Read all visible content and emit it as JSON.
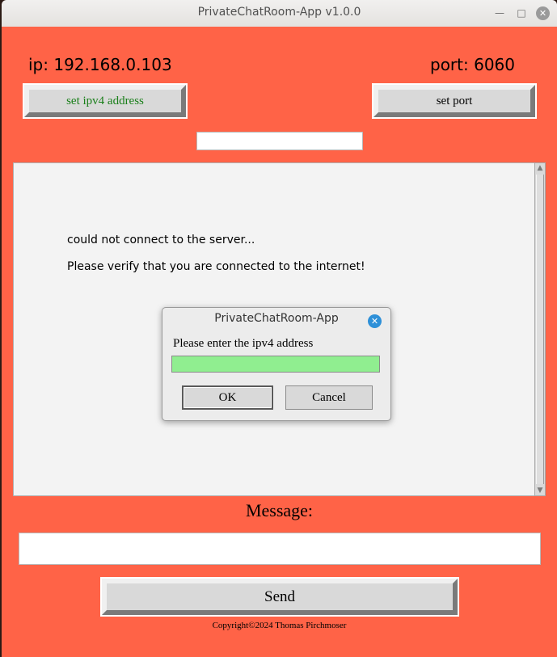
{
  "window": {
    "title": "PrivateChatRoom-App v1.0.0",
    "minimize_glyph": "—",
    "maximize_glyph": "□",
    "close_glyph": "✕"
  },
  "colors": {
    "background": "#ff6347",
    "dialog_entry": "#90ee90",
    "ip_button_text": "#1a7f1a"
  },
  "connection": {
    "ip_label": "ip: 192.168.0.103",
    "port_label": "port: 6060",
    "set_ip_button": "set ipv4 address",
    "set_port_button": "set port",
    "value_input": ""
  },
  "chat": {
    "lines": [
      "could not connect to the server...",
      "Please verify that you are connected to the internet!"
    ],
    "scroll_up_glyph": "▲",
    "scroll_down_glyph": "▼"
  },
  "composer": {
    "label": "Message:",
    "input_value": "",
    "send_button": "Send"
  },
  "footer": {
    "copyright": "Copyright©2024 Thomas Pirchmoser"
  },
  "dialog": {
    "title": "PrivateChatRoom-App",
    "close_glyph": "✕",
    "prompt": "Please enter the ipv4 address",
    "input_value": "",
    "ok_button": "OK",
    "cancel_button": "Cancel"
  }
}
